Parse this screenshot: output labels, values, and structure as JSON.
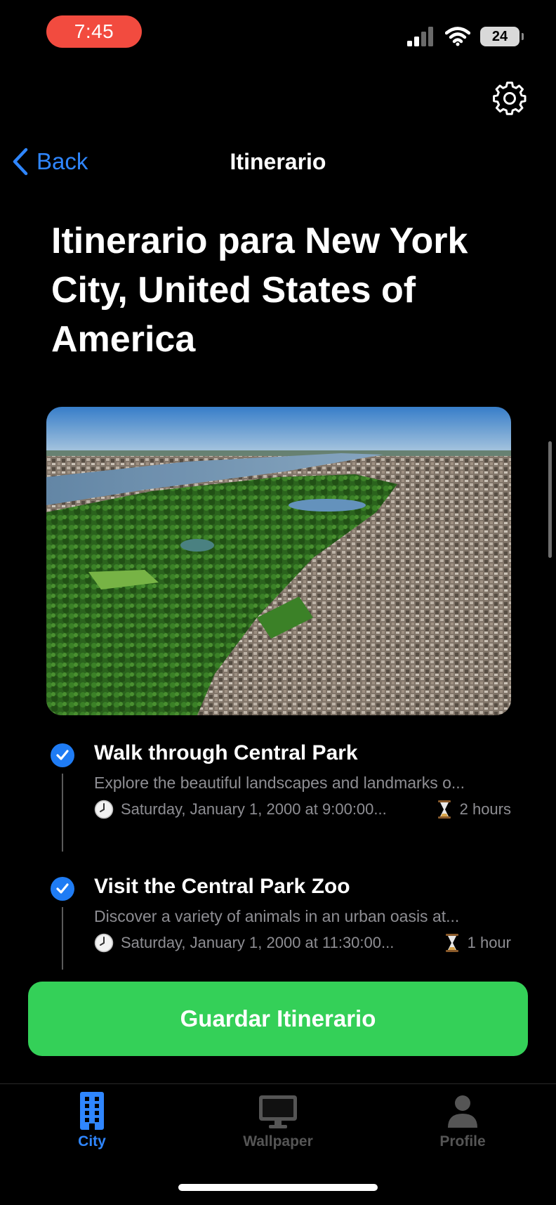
{
  "status": {
    "time": "7:45",
    "battery": "24"
  },
  "nav": {
    "back_label": "Back",
    "title": "Itinerario"
  },
  "page_title": "Itinerario para New York City, United States of America",
  "activities": [
    {
      "title": "Walk through Central Park",
      "description": "Explore the beautiful landscapes and landmarks o...",
      "datetime": "Saturday, January 1, 2000 at 9:00:00...",
      "duration": "2 hours",
      "done": true
    },
    {
      "title": "Visit the Central Park Zoo",
      "description": "Discover a variety of animals in an urban oasis at...",
      "datetime": "Saturday, January 1, 2000 at 11:30:00...",
      "duration": "1 hour",
      "done": true
    }
  ],
  "save_button_label": "Guardar Itinerario",
  "tabs": [
    {
      "label": "City",
      "icon": "building-icon",
      "active": true
    },
    {
      "label": "Wallpaper",
      "icon": "monitor-icon",
      "active": false
    },
    {
      "label": "Profile",
      "icon": "person-icon",
      "active": false
    }
  ],
  "colors": {
    "accent": "#2f86ff",
    "save_button": "#34d058",
    "status_time_bg": "#f24b3f",
    "check": "#1f7cf4"
  }
}
